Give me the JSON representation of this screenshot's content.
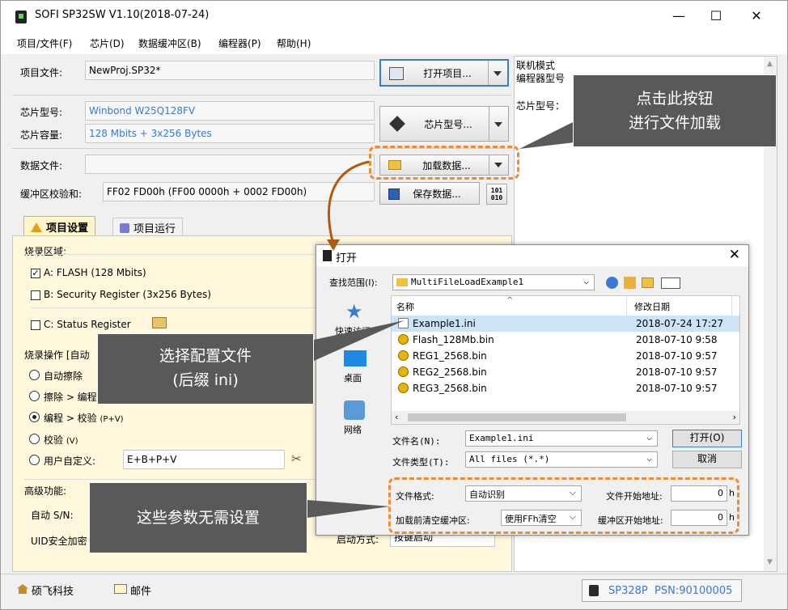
{
  "window": {
    "title": "SOFI SP32SW V1.10(2018-07-24)",
    "minimize": "—",
    "maximize": "☐",
    "close": "✕"
  },
  "menu": [
    "项目/文件(F)",
    "芯片(D)",
    "数据缓冲区(B)",
    "编程器(P)",
    "帮助(H)"
  ],
  "project": {
    "label": "项目文件:",
    "value": "NewProj.SP32*",
    "open_button": "打开项目..."
  },
  "chip": {
    "type_label": "芯片型号:",
    "type_value": "Winbond W25Q128FV",
    "size_label": "芯片容量:",
    "size_value": "128 Mbits + 3x256 Bytes",
    "button": "芯片型号..."
  },
  "data": {
    "file_label": "数据文件:",
    "file_value": "",
    "load_button": "加载数据...",
    "checksum_label": "缓冲区校验和:",
    "checksum_value": "FF02 FD00h (FF00 0000h + 0002 FD00h)",
    "save_button": "保存数据...",
    "bin_icon": "101\n010"
  },
  "right_pane": {
    "line1": "联机模式",
    "line2": "编程器型号",
    "line3": "芯片型号："
  },
  "tabs": {
    "settings": "项目设置",
    "run": "项目运行"
  },
  "burn_area": {
    "title": "烧录区域:",
    "a": "A: FLASH (128 Mbits)",
    "b": "B: Security Register (3x256 Bytes)",
    "c": "C: Status Register"
  },
  "burn_ops": {
    "title": "烧录操作 [自动",
    "opt1": "自动擦除 ",
    "opt2": "擦除 > 编程",
    "opt3": "编程 > 校验",
    "opt3_suffix": "(P+V)",
    "opt4": "校验",
    "opt4_suffix": "(V)",
    "opt5": "用户自定义:",
    "custom_value": "E+B+P+V"
  },
  "advanced": {
    "title": "高级功能:",
    "sn": "自动 S/N:",
    "uid": "UID安全加密",
    "start_mode": "启动方式:",
    "start_value": "按键启动"
  },
  "callouts": {
    "load": [
      "点击此按钮",
      "进行文件加载"
    ],
    "select": [
      "选择配置文件",
      "(后缀 ini)"
    ],
    "params": "这些参数无需设置"
  },
  "dialog": {
    "title": "打开",
    "lookin_label": "查找范围(I):",
    "lookin_value": "MultiFileLoadExample1",
    "sidebar": [
      "快速访问",
      "桌面",
      "网络"
    ],
    "col_name": "名称",
    "col_date": "修改日期",
    "col_more": "",
    "files": [
      {
        "name": "Example1.ini",
        "date": "2018-07-24 17:27",
        "type": "ini"
      },
      {
        "name": "Flash_128Mb.bin",
        "date": "2018-07-10 9:58",
        "type": "bin"
      },
      {
        "name": "REG1_2568.bin",
        "date": "2018-07-10 9:57",
        "type": "bin"
      },
      {
        "name": "REG2_2568.bin",
        "date": "2018-07-10 9:57",
        "type": "bin"
      },
      {
        "name": "REG3_2568.bin",
        "date": "2018-07-10 9:57",
        "type": "bin"
      }
    ],
    "filename_label": "文件名(N):",
    "filename_value": "Example1.ini",
    "filetype_label": "文件类型(T):",
    "filetype_value": "All files (*.*)",
    "open_button": "打开(O)",
    "cancel_button": "取消",
    "format_label": "文件格式:",
    "format_value": "自动识别",
    "file_start_label": "文件开始地址:",
    "file_start_value": "0",
    "clear_label": "加载前清空缓冲区:",
    "clear_value": "使用FFh清空",
    "buf_start_label": "缓冲区开始地址:",
    "buf_start_value": "0",
    "unit": "h"
  },
  "status": {
    "company": "硕飞科技",
    "mail": "邮件",
    "device": "SP328P  PSN:90100005"
  },
  "colors": {
    "callout": "#595959",
    "dash": "#f08a30",
    "link": "#3a77d8"
  }
}
